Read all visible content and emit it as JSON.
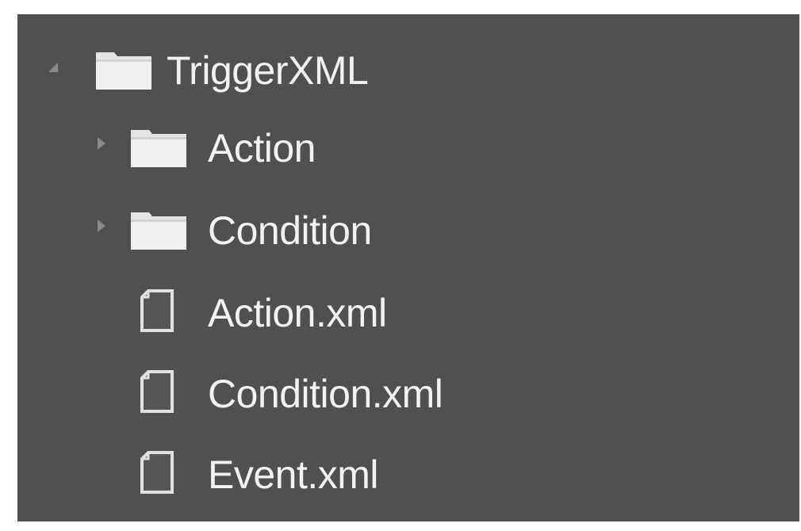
{
  "tree": {
    "root": {
      "label": "TriggerXML",
      "icon": "folder-icon",
      "expander": "expanded-triangle-icon",
      "children": [
        {
          "label": "Action",
          "icon": "folder-icon",
          "expander": "collapsed-triangle-icon"
        },
        {
          "label": "Condition",
          "icon": "folder-icon",
          "expander": "collapsed-triangle-icon"
        },
        {
          "label": "Action.xml",
          "icon": "xml-file-icon"
        },
        {
          "label": "Condition.xml",
          "icon": "xml-file-icon"
        },
        {
          "label": "Event.xml",
          "icon": "xml-file-icon"
        }
      ]
    }
  },
  "colors": {
    "background": "#505050",
    "text": "#f2f2f2",
    "folder": "#e8e8e8",
    "expander": "#8a8a8a"
  }
}
